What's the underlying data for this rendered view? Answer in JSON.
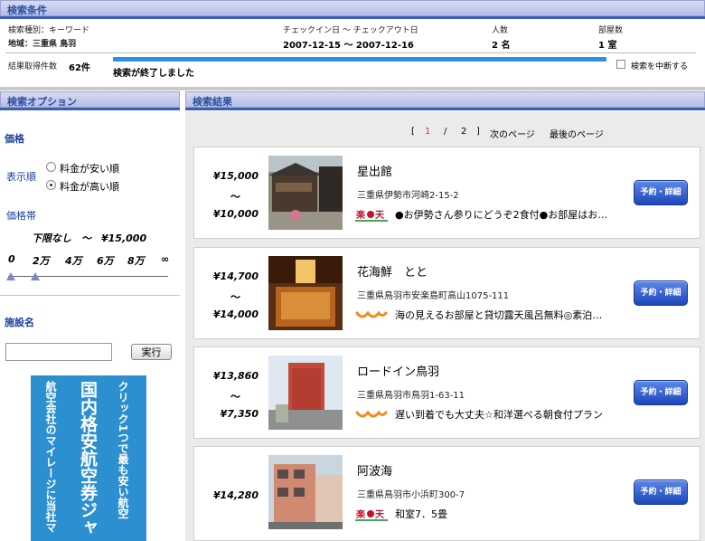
{
  "search_conditions": {
    "header": "検索条件",
    "type_label": "検索種別：キーワード",
    "area_label": "地域：三重県 鳥羽",
    "checkin_label": "チェックイン日 ～ チェックアウト日",
    "checkin_value": "2007-12-15 ～ 2007-12-16",
    "people_label": "人数",
    "people_value": "2 名",
    "rooms_label": "部屋数",
    "rooms_value": "1 室",
    "count_label": "結果取得件数",
    "count_value": "62件",
    "status": "検索が終了しました",
    "stop_label": "検索を中断する"
  },
  "options": {
    "header": "検索オプション",
    "price_title": "価格",
    "order_label": "表示順",
    "order_options": [
      "料金が安い順",
      "料金が高い順"
    ],
    "order_selected": 1,
    "range_label": "価格帯",
    "range_value": "下限なし　～　¥15,000",
    "ticks": [
      "0",
      "2万",
      "4万",
      "6万",
      "8万",
      "∞"
    ],
    "facility_title": "施設名",
    "facility_value": "",
    "run_label": "実行"
  },
  "ad": {
    "col1": "クリック1つで最も安い航空",
    "col2": "国内格安航空券ジャ",
    "col3": "航空会社のマイレージに当社マ"
  },
  "results": {
    "header": "検索結果",
    "pager": {
      "open": "[",
      "current": "1",
      "sep": "/",
      "page2": "2",
      "close": "]",
      "next": "次のページ",
      "last": "最後のページ"
    },
    "book_label": "予約・詳細",
    "tilde": "～",
    "items": [
      {
        "price_high": "¥15,000",
        "price_low": "¥10,000",
        "name": "星出館",
        "address": "三重県伊勢市河崎2-15-2",
        "brand": "楽天",
        "plan": "●お伊勢さん参りにどうぞ2食付●お部屋はお…"
      },
      {
        "price_high": "¥14,700",
        "price_low": "¥14,000",
        "name": "花海鮮　とと",
        "address": "三重県鳥羽市安楽島町高山1075-111",
        "brand": "jalan",
        "plan": "海の見えるお部屋と貸切露天風呂無料◎素泊…"
      },
      {
        "price_high": "¥13,860",
        "price_low": "¥7,350",
        "name": "ロードイン鳥羽",
        "address": "三重県鳥羽市鳥羽1-63-11",
        "brand": "jalan",
        "plan": "遅い到着でも大丈夫☆和洋選べる朝食付プラン"
      },
      {
        "price_high": "¥14,280",
        "price_low": "",
        "name": "阿波海",
        "address": "三重県鳥羽市小浜町300-7",
        "brand": "楽天",
        "plan": "和室7．5畳"
      }
    ]
  },
  "colors": {
    "accent": "#1a3fa0",
    "header_text": "#2b4f9f",
    "progress": "#2f8fe0",
    "book_button": "#2a55c7",
    "ad_background": "#2c8fd0",
    "rakuten_red": "#c8102e",
    "jalan_orange": "#f08a1c"
  }
}
